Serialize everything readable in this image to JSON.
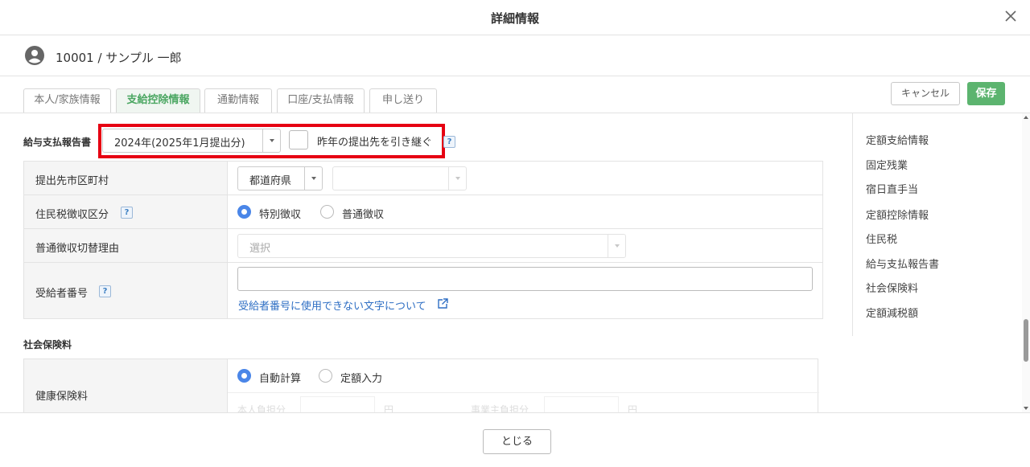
{
  "header": {
    "title": "詳細情報"
  },
  "user": {
    "name": "10001 / サンプル 一郎"
  },
  "tabs": [
    {
      "label": "本人/家族情報"
    },
    {
      "label": "支給控除情報"
    },
    {
      "label": "通勤情報"
    },
    {
      "label": "口座/支払情報"
    },
    {
      "label": "申し送り"
    }
  ],
  "actions": {
    "cancel": "キャンセル",
    "save": "保存"
  },
  "report": {
    "section_label": "給与支払報告書",
    "year_select": "2024年(2025年1月提出分)",
    "inherit_label": "昨年の提出先を引き継ぐ",
    "help": "?"
  },
  "form": {
    "municipality": {
      "label": "提出先市区町村",
      "pref_select": "都道府県",
      "city_select": ""
    },
    "collection": {
      "label": "住民税徴収区分",
      "help": "?",
      "option_special": "特別徴収",
      "option_normal": "普通徴収",
      "selected": "特別徴収"
    },
    "switch_reason": {
      "label": "普通徴収切替理由",
      "placeholder": "選択"
    },
    "recipient_no": {
      "label": "受給者番号",
      "help": "?",
      "value": "",
      "link": "受給者番号に使用できない文字について"
    }
  },
  "insurance": {
    "section_label": "社会保険料",
    "health": {
      "label": "健康保険料",
      "option_auto": "自動計算",
      "option_fixed": "定額入力",
      "selected": "自動計算",
      "self_label": "本人負担分",
      "employer_label": "事業主負担分",
      "unit": "円"
    }
  },
  "side_nav": [
    {
      "label": "定額支給情報"
    },
    {
      "label": "固定残業"
    },
    {
      "label": "宿日直手当"
    },
    {
      "label": "定額控除情報"
    },
    {
      "label": "住民税"
    },
    {
      "label": "給与支払報告書"
    },
    {
      "label": "社会保険料"
    },
    {
      "label": "定額減税額"
    }
  ],
  "footer": {
    "close": "とじる"
  },
  "colors": {
    "accent_green": "#5cb46f",
    "radio_blue": "#4a86e8",
    "highlight_red": "#e60012",
    "link_blue": "#2f6fc4"
  }
}
